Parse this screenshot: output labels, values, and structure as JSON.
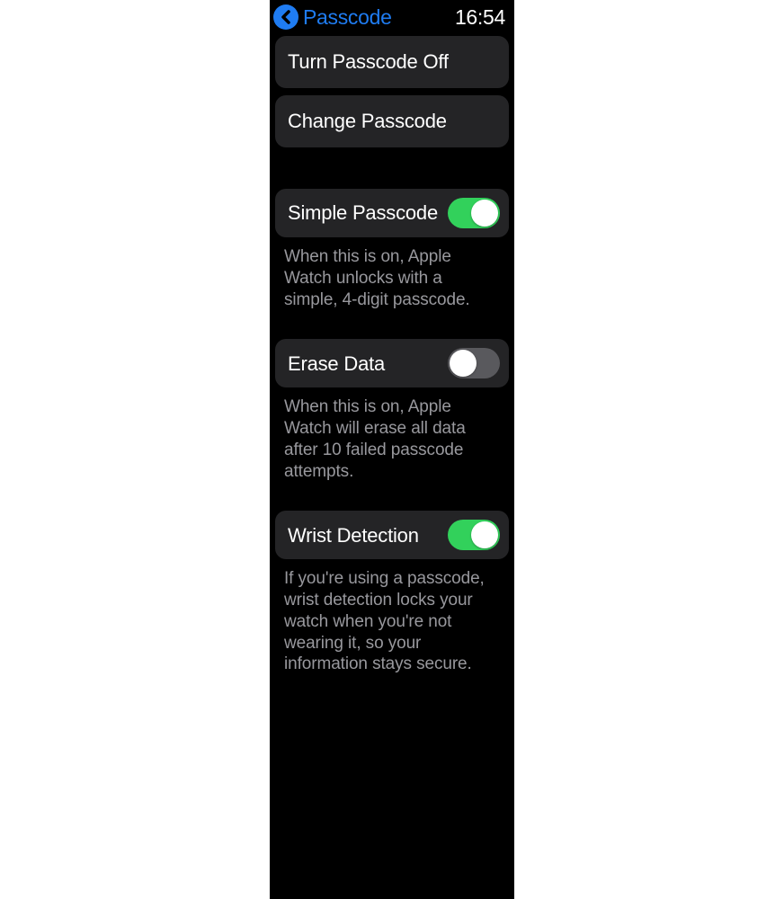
{
  "header": {
    "title": "Passcode",
    "time": "16:54"
  },
  "buttons": {
    "turn_off": "Turn Passcode Off",
    "change": "Change Passcode"
  },
  "simple": {
    "label": "Simple Passcode",
    "on": true,
    "desc": "When this is on, Apple Watch unlocks with a simple, 4-digit passcode."
  },
  "erase": {
    "label": "Erase Data",
    "on": false,
    "desc": "When this is on, Apple Watch will erase all data after 10 failed passcode attempts."
  },
  "wrist": {
    "label": "Wrist Detection",
    "on": true,
    "desc": "If you're using a passcode, wrist detection locks your watch when you're not wearing it, so your information stays secure."
  }
}
